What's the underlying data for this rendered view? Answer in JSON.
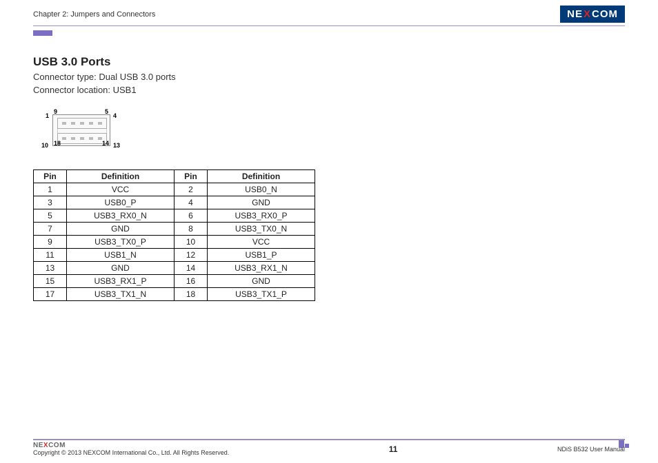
{
  "header": {
    "chapter": "Chapter 2: Jumpers and Connectors",
    "logo_pre": "NE",
    "logo_x": "X",
    "logo_post": "COM"
  },
  "section": {
    "title": "USB 3.0 Ports",
    "type_line": "Connector type: Dual USB 3.0 ports",
    "loc_line": "Connector location: USB1"
  },
  "diagram_labels": {
    "p1": "1",
    "p4": "4",
    "p5": "5",
    "p9": "9",
    "p10": "10",
    "p13": "13",
    "p14": "14",
    "p18": "18"
  },
  "table": {
    "headers": {
      "pin": "Pin",
      "def": "Definition"
    },
    "rows": [
      {
        "pa": "1",
        "da": "VCC",
        "pb": "2",
        "db": "USB0_N"
      },
      {
        "pa": "3",
        "da": "USB0_P",
        "pb": "4",
        "db": "GND"
      },
      {
        "pa": "5",
        "da": "USB3_RX0_N",
        "pb": "6",
        "db": "USB3_RX0_P"
      },
      {
        "pa": "7",
        "da": "GND",
        "pb": "8",
        "db": "USB3_TX0_N"
      },
      {
        "pa": "9",
        "da": "USB3_TX0_P",
        "pb": "10",
        "db": "VCC"
      },
      {
        "pa": "11",
        "da": "USB1_N",
        "pb": "12",
        "db": "USB1_P"
      },
      {
        "pa": "13",
        "da": "GND",
        "pb": "14",
        "db": "USB3_RX1_N"
      },
      {
        "pa": "15",
        "da": "USB3_RX1_P",
        "pb": "16",
        "db": "GND"
      },
      {
        "pa": "17",
        "da": "USB3_TX1_N",
        "pb": "18",
        "db": "USB3_TX1_P"
      }
    ]
  },
  "footer": {
    "logo_pre": "NE",
    "logo_x": "X",
    "logo_post": "COM",
    "copyright": "Copyright © 2013 NEXCOM International Co., Ltd. All Rights Reserved.",
    "page": "11",
    "manual": "NDiS B532 User Manual"
  }
}
